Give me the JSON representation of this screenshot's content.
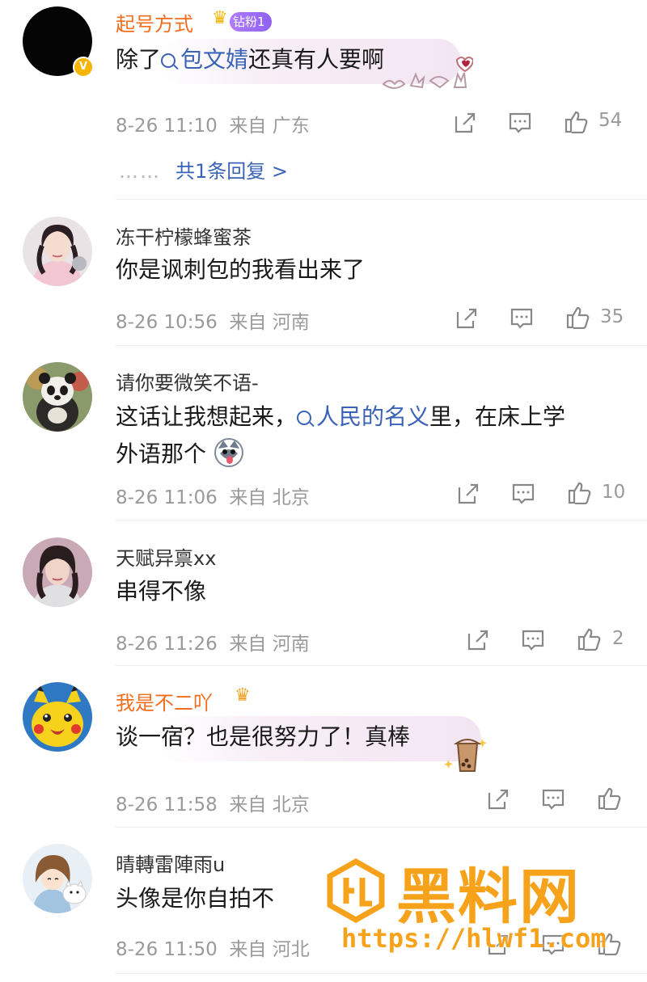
{
  "comments": [
    {
      "username": "起号方式",
      "badge": "钻粉1",
      "text_before": "除了",
      "topic": "包文婧",
      "text_after": "还真有人要啊",
      "time": "8-26 11:10",
      "location": "来自 广东",
      "likes": "54",
      "replies": "共1条回复 >",
      "replies_dots": "……"
    },
    {
      "username": "冻干柠檬蜂蜜茶",
      "text": "你是讽刺包的我看出来了",
      "time": "8-26 10:56",
      "location": "来自 河南",
      "likes": "35"
    },
    {
      "username": "请你要微笑不语-",
      "text_before": "这话让我想起来，",
      "topic": "人民的名义",
      "text_after": "里，在床上学",
      "text_line2": "外语那个",
      "time": "8-26 11:06",
      "location": "来自 北京",
      "likes": "10"
    },
    {
      "username": "天赋异禀xx",
      "text": "串得不像",
      "time": "8-26 11:26",
      "location": "来自 河南",
      "likes": "2"
    },
    {
      "username": "我是不二吖",
      "text": "谈一宿？也是很努力了！真棒",
      "time": "8-26 11:58",
      "location": "来自 北京",
      "likes": ""
    },
    {
      "username": "晴轉雷陣雨u",
      "text": "头像是你自拍不",
      "time": "8-26 11:50",
      "location": "来自 河北",
      "likes": ""
    }
  ],
  "watermark": {
    "title": "黑料网",
    "url": "https://hlwf1.com",
    "color": "#f7a21b"
  },
  "colors": {
    "vip_name": "#f26d1e",
    "topic_link": "#3a63b8",
    "meta": "#9a9a9a"
  },
  "icons": [
    "verified-badge-icon",
    "crown-icon",
    "share-icon",
    "comment-icon",
    "thumbs-up-icon",
    "topic-search-icon"
  ]
}
